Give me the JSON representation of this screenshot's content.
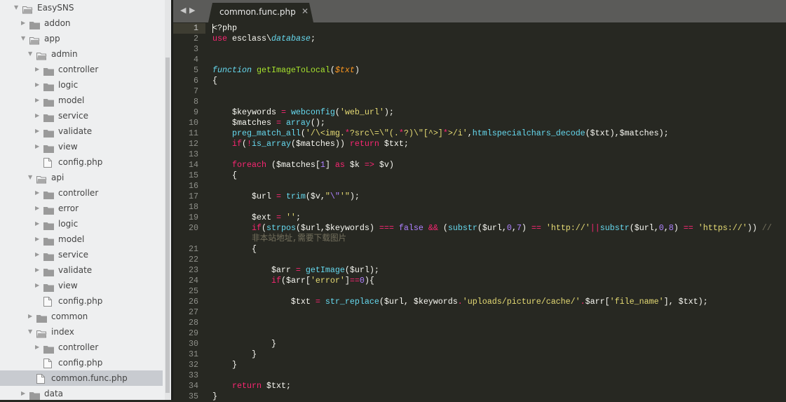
{
  "sidebar": {
    "items": [
      {
        "label": "EasySNS",
        "level": 0,
        "type": "folder-open"
      },
      {
        "label": "addon",
        "level": 1,
        "type": "folder"
      },
      {
        "label": "app",
        "level": 1,
        "type": "folder-open"
      },
      {
        "label": "admin",
        "level": 2,
        "type": "folder-open"
      },
      {
        "label": "controller",
        "level": 3,
        "type": "folder"
      },
      {
        "label": "logic",
        "level": 3,
        "type": "folder"
      },
      {
        "label": "model",
        "level": 3,
        "type": "folder"
      },
      {
        "label": "service",
        "level": 3,
        "type": "folder"
      },
      {
        "label": "validate",
        "level": 3,
        "type": "folder"
      },
      {
        "label": "view",
        "level": 3,
        "type": "folder"
      },
      {
        "label": "config.php",
        "level": 3,
        "type": "file"
      },
      {
        "label": "api",
        "level": 2,
        "type": "folder-open"
      },
      {
        "label": "controller",
        "level": 3,
        "type": "folder"
      },
      {
        "label": "error",
        "level": 3,
        "type": "folder"
      },
      {
        "label": "logic",
        "level": 3,
        "type": "folder"
      },
      {
        "label": "model",
        "level": 3,
        "type": "folder"
      },
      {
        "label": "service",
        "level": 3,
        "type": "folder"
      },
      {
        "label": "validate",
        "level": 3,
        "type": "folder"
      },
      {
        "label": "view",
        "level": 3,
        "type": "folder"
      },
      {
        "label": "config.php",
        "level": 3,
        "type": "file"
      },
      {
        "label": "common",
        "level": 2,
        "type": "folder"
      },
      {
        "label": "index",
        "level": 2,
        "type": "folder-open"
      },
      {
        "label": "controller",
        "level": 3,
        "type": "folder"
      },
      {
        "label": "config.php",
        "level": 3,
        "type": "file"
      },
      {
        "label": "common.func.php",
        "level": 2,
        "type": "file",
        "selected": true
      },
      {
        "label": "data",
        "level": 1,
        "type": "folder"
      }
    ]
  },
  "tabs": {
    "nav_back": "◀",
    "nav_forward": "▶",
    "active": "common.func.php",
    "close": "✕"
  },
  "editor": {
    "current_line": 1,
    "lines": [
      {
        "n": "1",
        "t": [
          [
            "p",
            "<?php"
          ]
        ]
      },
      {
        "n": "2",
        "t": [
          [
            "k",
            "use"
          ],
          [
            "p",
            " esclass\\"
          ],
          [
            "i",
            "database"
          ],
          [
            "p",
            ";"
          ]
        ]
      },
      {
        "n": "3",
        "t": []
      },
      {
        "n": "4",
        "t": []
      },
      {
        "n": "5",
        "t": [
          [
            "i",
            "function"
          ],
          [
            "p",
            " "
          ],
          [
            "g",
            "getImageToLocal"
          ],
          [
            "p",
            "("
          ],
          [
            "v",
            "$txt"
          ],
          [
            "p",
            ")"
          ]
        ]
      },
      {
        "n": "6",
        "t": [
          [
            "p",
            "{"
          ]
        ]
      },
      {
        "n": "7",
        "t": []
      },
      {
        "n": "8",
        "t": []
      },
      {
        "n": "9",
        "t": [
          [
            "p",
            "    $keywords "
          ],
          [
            "k",
            "="
          ],
          [
            "p",
            " "
          ],
          [
            "f",
            "webconfig"
          ],
          [
            "p",
            "("
          ],
          [
            "s",
            "'web_url'"
          ],
          [
            "p",
            ");"
          ]
        ]
      },
      {
        "n": "10",
        "t": [
          [
            "p",
            "    $matches "
          ],
          [
            "k",
            "="
          ],
          [
            "p",
            " "
          ],
          [
            "f",
            "array"
          ],
          [
            "p",
            "();"
          ]
        ]
      },
      {
        "n": "11",
        "t": [
          [
            "p",
            "    "
          ],
          [
            "f",
            "preg_match_all"
          ],
          [
            "p",
            "("
          ],
          [
            "s",
            "'/\\<img."
          ],
          [
            "k",
            "*"
          ],
          [
            "s",
            "?src\\=\\\"(."
          ],
          [
            "k",
            "*"
          ],
          [
            "s",
            "?)\\\"[^>]"
          ],
          [
            "k",
            "*"
          ],
          [
            "s",
            ">/i'"
          ],
          [
            "p",
            ","
          ],
          [
            "f",
            "htmlspecialchars_decode"
          ],
          [
            "p",
            "($txt),$matches);"
          ]
        ]
      },
      {
        "n": "12",
        "t": [
          [
            "p",
            "    "
          ],
          [
            "k",
            "if"
          ],
          [
            "p",
            "("
          ],
          [
            "k",
            "!"
          ],
          [
            "f",
            "is_array"
          ],
          [
            "p",
            "($matches)) "
          ],
          [
            "k",
            "return"
          ],
          [
            "p",
            " $txt;"
          ]
        ]
      },
      {
        "n": "13",
        "t": []
      },
      {
        "n": "14",
        "t": [
          [
            "p",
            "    "
          ],
          [
            "k",
            "foreach"
          ],
          [
            "p",
            " ($matches["
          ],
          [
            "n",
            "1"
          ],
          [
            "p",
            "] "
          ],
          [
            "k",
            "as"
          ],
          [
            "p",
            " $k "
          ],
          [
            "k",
            "=>"
          ],
          [
            "p",
            " $v)"
          ]
        ]
      },
      {
        "n": "15",
        "t": [
          [
            "p",
            "    {"
          ]
        ]
      },
      {
        "n": "16",
        "t": []
      },
      {
        "n": "17",
        "t": [
          [
            "p",
            "        $url "
          ],
          [
            "k",
            "="
          ],
          [
            "p",
            " "
          ],
          [
            "f",
            "trim"
          ],
          [
            "p",
            "($v,"
          ],
          [
            "s",
            "\""
          ],
          [
            "n",
            "\\\""
          ],
          [
            "s",
            "'\""
          ],
          [
            "p",
            ");"
          ]
        ]
      },
      {
        "n": "18",
        "t": []
      },
      {
        "n": "19",
        "t": [
          [
            "p",
            "        $ext "
          ],
          [
            "k",
            "="
          ],
          [
            "p",
            " "
          ],
          [
            "s",
            "''"
          ],
          [
            "p",
            ";"
          ]
        ]
      },
      {
        "n": "20",
        "t": [
          [
            "p",
            "        "
          ],
          [
            "k",
            "if"
          ],
          [
            "p",
            "("
          ],
          [
            "f",
            "strpos"
          ],
          [
            "p",
            "($url,$keywords) "
          ],
          [
            "k",
            "==="
          ],
          [
            "p",
            " "
          ],
          [
            "n",
            "false"
          ],
          [
            "p",
            " "
          ],
          [
            "k",
            "&&"
          ],
          [
            "p",
            " ("
          ],
          [
            "f",
            "substr"
          ],
          [
            "p",
            "($url,"
          ],
          [
            "n",
            "0"
          ],
          [
            "p",
            ","
          ],
          [
            "n",
            "7"
          ],
          [
            "p",
            ") "
          ],
          [
            "k",
            "=="
          ],
          [
            "p",
            " "
          ],
          [
            "s",
            "'http://'"
          ],
          [
            "k",
            "||"
          ],
          [
            "f",
            "substr"
          ],
          [
            "p",
            "($url,"
          ],
          [
            "n",
            "0"
          ],
          [
            "p",
            ","
          ],
          [
            "n",
            "8"
          ],
          [
            "p",
            ") "
          ],
          [
            "k",
            "=="
          ],
          [
            "p",
            " "
          ],
          [
            "s",
            "'https://'"
          ],
          [
            "p",
            ")) "
          ],
          [
            "c",
            "//"
          ]
        ],
        "wrap": [
          [
            "p",
            "        "
          ],
          [
            "c",
            "非本站地址,需要下载图片"
          ]
        ]
      },
      {
        "n": "21",
        "t": [
          [
            "p",
            "        {"
          ]
        ]
      },
      {
        "n": "22",
        "t": []
      },
      {
        "n": "23",
        "t": [
          [
            "p",
            "            $arr "
          ],
          [
            "k",
            "="
          ],
          [
            "p",
            " "
          ],
          [
            "f",
            "getImage"
          ],
          [
            "p",
            "($url);"
          ]
        ]
      },
      {
        "n": "24",
        "t": [
          [
            "p",
            "            "
          ],
          [
            "k",
            "if"
          ],
          [
            "p",
            "($arr["
          ],
          [
            "s",
            "'error'"
          ],
          [
            "p",
            "]"
          ],
          [
            "k",
            "=="
          ],
          [
            "n",
            "0"
          ],
          [
            "p",
            "){"
          ]
        ]
      },
      {
        "n": "25",
        "t": []
      },
      {
        "n": "26",
        "t": [
          [
            "p",
            "                $txt "
          ],
          [
            "k",
            "="
          ],
          [
            "p",
            " "
          ],
          [
            "f",
            "str_replace"
          ],
          [
            "p",
            "($url, $keywords"
          ],
          [
            "k",
            "."
          ],
          [
            "s",
            "'uploads/picture/cache/'"
          ],
          [
            "k",
            "."
          ],
          [
            "p",
            "$arr["
          ],
          [
            "s",
            "'file_name'"
          ],
          [
            "p",
            "], $txt);"
          ]
        ]
      },
      {
        "n": "27",
        "t": []
      },
      {
        "n": "28",
        "t": []
      },
      {
        "n": "29",
        "t": []
      },
      {
        "n": "30",
        "t": [
          [
            "p",
            "            }"
          ]
        ]
      },
      {
        "n": "31",
        "t": [
          [
            "p",
            "        }"
          ]
        ]
      },
      {
        "n": "32",
        "t": [
          [
            "p",
            "    }"
          ]
        ]
      },
      {
        "n": "33",
        "t": []
      },
      {
        "n": "34",
        "t": [
          [
            "p",
            "    "
          ],
          [
            "k",
            "return"
          ],
          [
            "p",
            " $txt;"
          ]
        ]
      },
      {
        "n": "35",
        "t": [
          [
            "p",
            "}"
          ]
        ]
      }
    ]
  },
  "colors": {
    "editor_bg": "#272822",
    "keyword": "#f92672",
    "function": "#66d9ef",
    "string": "#e6db74",
    "number": "#ae81ff",
    "variable": "#fd971f",
    "comment": "#75715e",
    "entity": "#a6e22e",
    "sidebar_bg": "#eeeff0",
    "selected_bg": "#c8cbd0"
  }
}
